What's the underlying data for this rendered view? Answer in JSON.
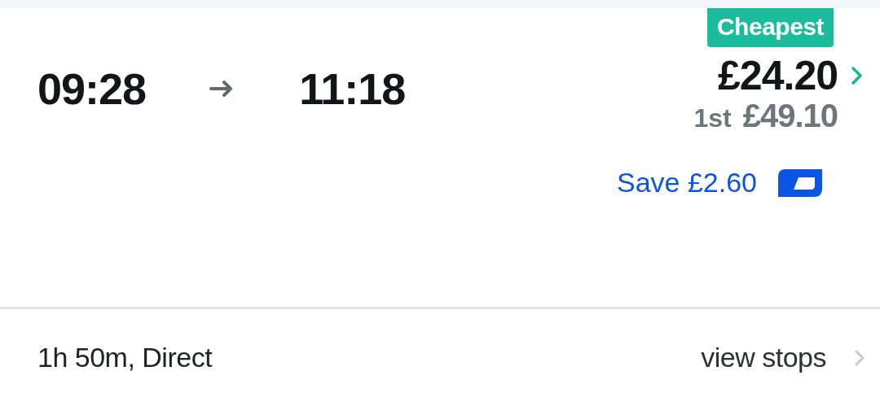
{
  "journey": {
    "departure": "09:28",
    "arrival": "11:18",
    "badge": "Cheapest",
    "price": "£24.20",
    "first_class_label": "1st",
    "first_class_price": "£49.10",
    "saving": "Save £2.60"
  },
  "footer": {
    "summary": "1h 50m, Direct",
    "link": "view stops"
  }
}
